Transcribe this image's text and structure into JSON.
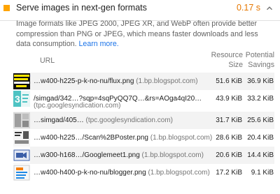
{
  "audit": {
    "title": "Serve images in next-gen formats",
    "savings": "0.17 s",
    "status_color": "#ffa400",
    "description": "Image formats like JPEG 2000, JPEG XR, and WebP often provide better compression than PNG or JPEG, which means faster downloads and less data consumption.",
    "learn_more": "Learn more."
  },
  "table": {
    "headers": {
      "url": "URL",
      "size_line1": "Resource",
      "size_line2": "Size",
      "savings_line1": "Potential",
      "savings_line2": "Savings"
    },
    "rows": [
      {
        "url": "…w400-h225-p-k-no-nu/flux.png",
        "host": "(1.bp.blogspot.com)",
        "size": "51.6 KiB",
        "savings": "36.9 KiB",
        "thumb_icon": "flux-thumbnail-icon"
      },
      {
        "url": "/simgad/342…?sqp=4sqPyQQ7Q…&rs=AOga4qI20…",
        "host": "(tpc.googlesyndication.com)",
        "size": "43.9 KiB",
        "savings": "33.2 KiB",
        "thumb_icon": "ad-thumbnail-icon"
      },
      {
        "url": "…simgad/405…",
        "host": "(tpc.googlesyndication.com)",
        "size": "31.7 KiB",
        "savings": "25.6 KiB",
        "thumb_icon": "ad-thumbnail-icon"
      },
      {
        "url": "…w400-h225…/Scan%2BPoster.png",
        "host": "(1.bp.blogspot.com)",
        "size": "28.6 KiB",
        "savings": "20.4 KiB",
        "thumb_icon": "poster-thumbnail-icon"
      },
      {
        "url": "…w300-h168…/Googlemeet1.png",
        "host": "(1.bp.blogspot.com)",
        "size": "20.6 KiB",
        "savings": "14.4 KiB",
        "thumb_icon": "meet-thumbnail-icon"
      },
      {
        "url": "…w400-h400-p-k-no-nu/blogger.png",
        "host": "(1.bp.blogspot.com)",
        "size": "17.2 KiB",
        "savings": "9.1 KiB",
        "thumb_icon": "blogger-thumbnail-icon"
      }
    ]
  }
}
